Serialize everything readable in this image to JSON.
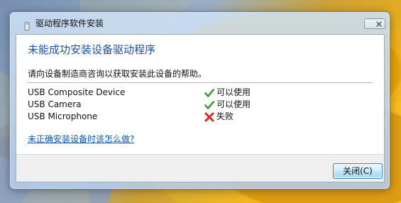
{
  "window": {
    "title": "驱动程序软件安装",
    "icons": {
      "app": "usb-device-icon",
      "close": "close-icon"
    }
  },
  "main": {
    "heading": "未能成功安装设备驱动程序",
    "instruction": "请向设备制造商咨询以获取安装此设备的帮助。",
    "devices": [
      {
        "name": "USB Composite Device",
        "status": "可以使用",
        "status_icon": "check-icon",
        "status_color": "#3f9b37"
      },
      {
        "name": "USB Camera",
        "status": "可以使用",
        "status_icon": "check-icon",
        "status_color": "#3f9b37"
      },
      {
        "name": "USB Microphone",
        "status": "失败",
        "status_icon": "error-x-icon",
        "status_color": "#d62d20"
      }
    ],
    "help_link": "未正确安装设备时该怎么做?"
  },
  "footer": {
    "close_button": "关闭(C)"
  },
  "colors": {
    "heading": "#1f4ea3",
    "link": "#0a58b0",
    "button_border": "#3c7fb1"
  }
}
